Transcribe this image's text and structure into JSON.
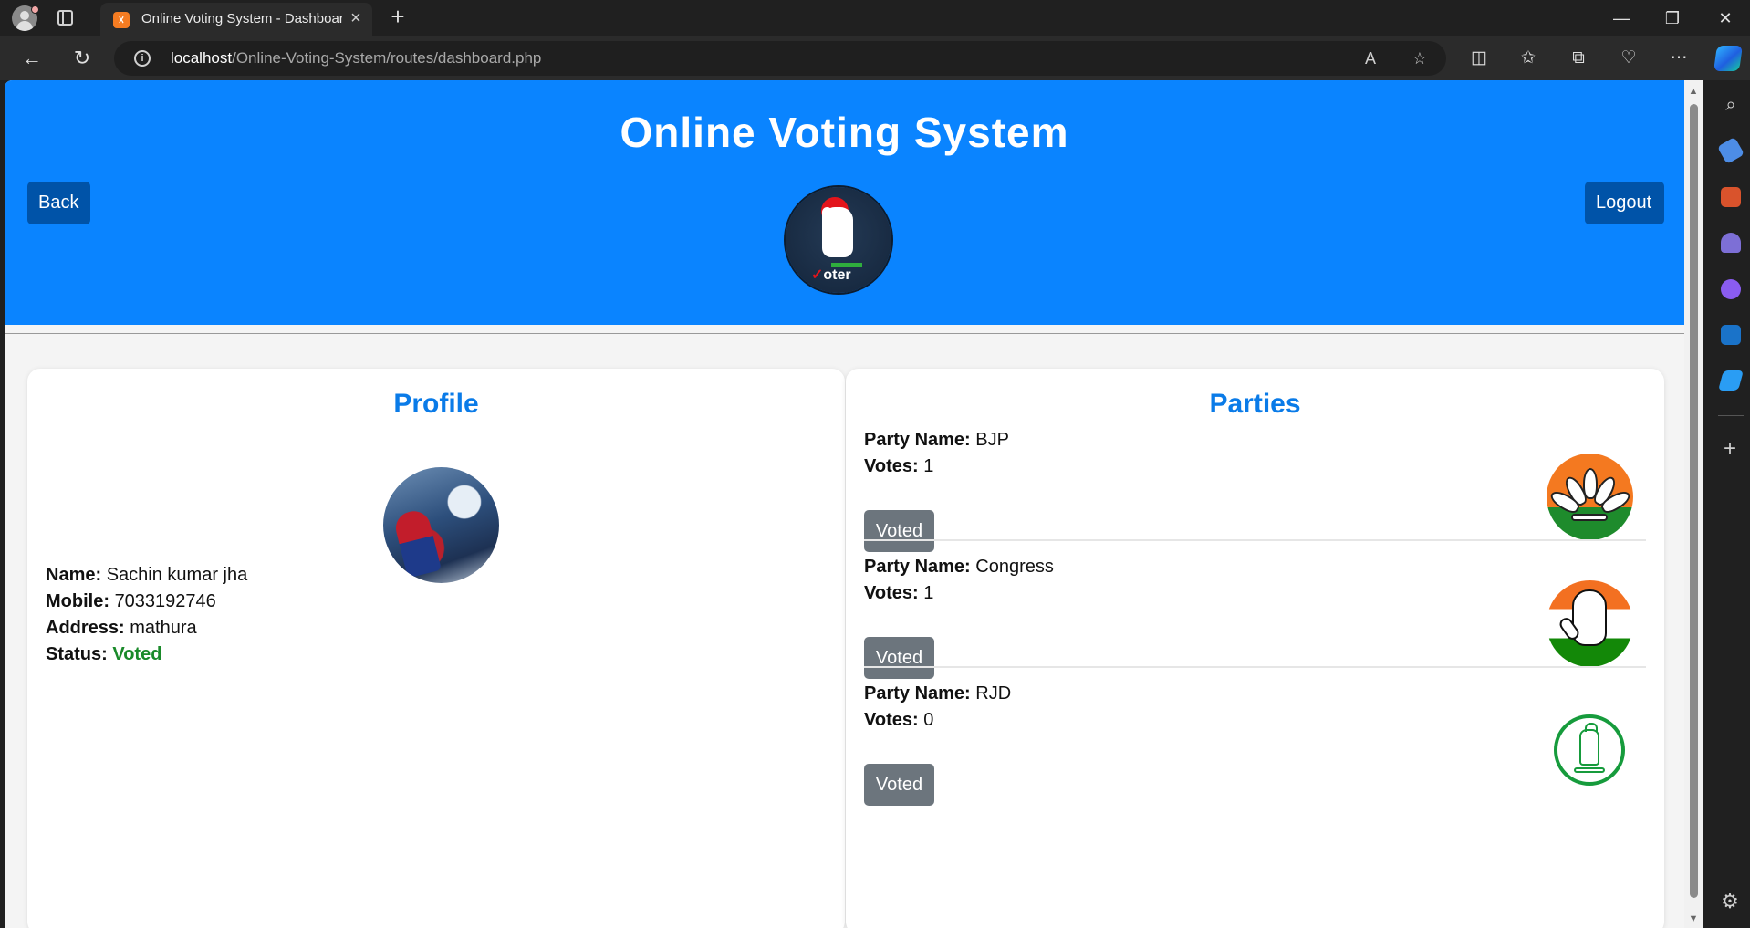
{
  "browser": {
    "tab_title": "Online Voting System - Dashboard",
    "tab_favicon": "xampp-icon",
    "url_host": "localhost",
    "url_path": "/Online-Voting-System/routes/dashboard.php",
    "win_minimize": "—",
    "win_restore": "❐",
    "win_close": "✕"
  },
  "header": {
    "title": "Online Voting System",
    "back_label": "Back",
    "logout_label": "Logout",
    "logo_text": "oter",
    "logo_check": "✓",
    "bg_color": "#0a84ff"
  },
  "profile": {
    "heading": "Profile",
    "name_label": "Name:",
    "name_value": "Sachin kumar jha",
    "mobile_label": "Mobile:",
    "mobile_value": "7033192746",
    "address_label": "Address:",
    "address_value": "mathura",
    "status_label": "Status:",
    "status_value": "Voted",
    "status_color": "#1a8a2a"
  },
  "parties": {
    "heading": "Parties",
    "party_name_label": "Party Name:",
    "votes_label": "Votes:",
    "items": [
      {
        "name": "BJP",
        "votes": "1",
        "button": "Voted",
        "logo": "lotus-icon"
      },
      {
        "name": "Congress",
        "votes": "1",
        "button": "Voted",
        "logo": "hand-icon"
      },
      {
        "name": "RJD",
        "votes": "0",
        "button": "Voted",
        "logo": "lantern-icon"
      }
    ]
  }
}
